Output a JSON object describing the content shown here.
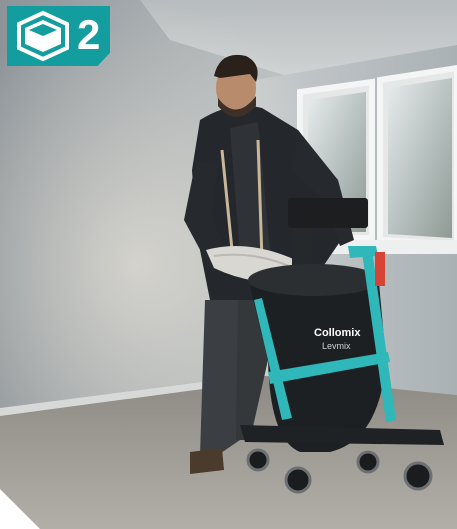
{
  "step_badge": {
    "number": "2",
    "color": "#139d9e",
    "icon": "hexagon-step-icon"
  },
  "scene": {
    "machine_brand": "Collomix",
    "machine_model": "Levmix"
  }
}
